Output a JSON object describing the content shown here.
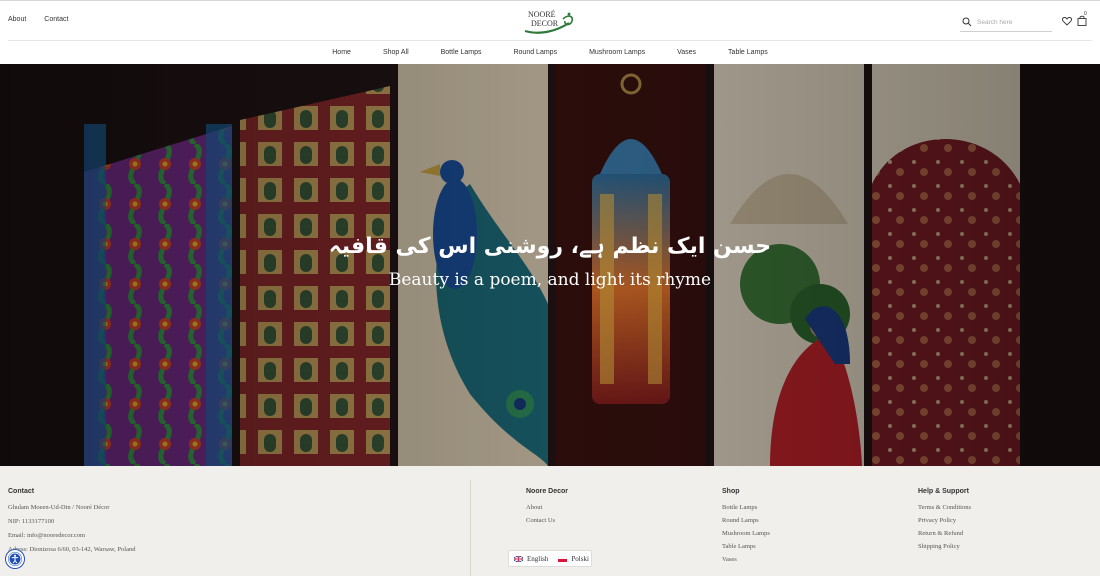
{
  "header": {
    "top_links": [
      "About",
      "Contact"
    ],
    "logo_text_line1": "NOORÉ",
    "logo_text_line2": "DECOR",
    "search_placeholder": "Search here",
    "cart_count": "0",
    "nav": [
      "Home",
      "Shop All",
      "Bottle Lamps",
      "Round Lamps",
      "Mushroom Lamps",
      "Vases",
      "Table Lamps"
    ]
  },
  "hero": {
    "urdu_line": "حسن ایک نظم ہے، روشنی اس کی قافیہ",
    "english_line": "Beauty is a poem, and light its rhyme"
  },
  "footer": {
    "contact": {
      "title": "Contact",
      "lines": [
        "Ghulam Moeen-Ud-Din / Nooré Décor",
        "NIP: 1133177100",
        "Email: info@nooredecor.com",
        "Adress: Dionizosa 6/60, 03-142, Warsaw, Poland"
      ]
    },
    "brand": {
      "title": "Noore Decor",
      "links": [
        "About",
        "Contact Us"
      ]
    },
    "shop": {
      "title": "Shop",
      "links": [
        "Bottle Lamps",
        "Round Lamps",
        "Mushroom Lamps",
        "Table Lamps",
        "Vases"
      ]
    },
    "help": {
      "title": "Help & Support",
      "links": [
        "Terms & Conditions",
        "Privacy Policy",
        "Return & Refund",
        "Shipping Policy"
      ]
    },
    "languages": [
      "English",
      "Polski"
    ]
  },
  "colors": {
    "hero_bg": "#221517",
    "footer_bg": "#f1efeb",
    "a11y_button": "#1f4fb5",
    "logo_green": "#2f7a3a"
  }
}
